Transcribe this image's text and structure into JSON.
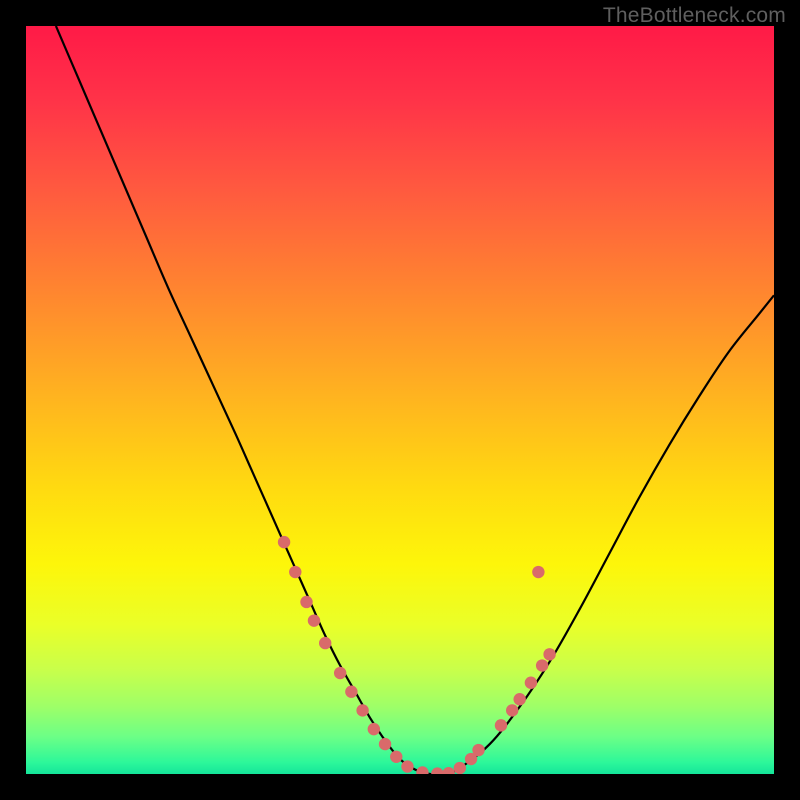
{
  "attribution": "TheBottleneck.com",
  "colors": {
    "frame": "#000000",
    "curve": "#000000",
    "marker": "#d96a6a",
    "gradient_stops": [
      {
        "offset": 0.0,
        "color": "#ff1a47"
      },
      {
        "offset": 0.1,
        "color": "#ff3348"
      },
      {
        "offset": 0.22,
        "color": "#ff5a3f"
      },
      {
        "offset": 0.35,
        "color": "#ff8430"
      },
      {
        "offset": 0.5,
        "color": "#ffb51f"
      },
      {
        "offset": 0.62,
        "color": "#ffdb10"
      },
      {
        "offset": 0.72,
        "color": "#fdf60a"
      },
      {
        "offset": 0.8,
        "color": "#eaff28"
      },
      {
        "offset": 0.86,
        "color": "#c9ff4a"
      },
      {
        "offset": 0.91,
        "color": "#9eff68"
      },
      {
        "offset": 0.95,
        "color": "#6cff86"
      },
      {
        "offset": 0.985,
        "color": "#2cf79a"
      },
      {
        "offset": 1.0,
        "color": "#14e59a"
      }
    ]
  },
  "chart_data": {
    "type": "line",
    "title": "",
    "xlabel": "",
    "ylabel": "",
    "xlim": [
      0,
      100
    ],
    "ylim": [
      0,
      100
    ],
    "grid": false,
    "legend": false,
    "series": [
      {
        "name": "bottleneck-curve",
        "x": [
          4,
          7,
          10,
          13,
          16,
          19,
          22,
          25,
          28,
          30,
          32,
          34,
          36,
          38,
          40,
          42,
          44,
          46,
          48,
          50,
          52,
          54,
          56,
          58,
          62,
          66,
          70,
          74,
          78,
          82,
          86,
          90,
          94,
          98,
          100
        ],
        "y": [
          100,
          93,
          86,
          79,
          72,
          65,
          58.5,
          52,
          45.5,
          41,
          36.5,
          32,
          27.5,
          23,
          18.5,
          14.5,
          11,
          7.5,
          4.5,
          2,
          0.6,
          0,
          0,
          0.8,
          4,
          9,
          15,
          22,
          29.5,
          37,
          44,
          50.5,
          56.5,
          61.5,
          64
        ]
      }
    ],
    "markers": [
      {
        "x": 34.5,
        "y": 31
      },
      {
        "x": 36,
        "y": 27
      },
      {
        "x": 37.5,
        "y": 23
      },
      {
        "x": 38.5,
        "y": 20.5
      },
      {
        "x": 40,
        "y": 17.5
      },
      {
        "x": 42,
        "y": 13.5
      },
      {
        "x": 43.5,
        "y": 11
      },
      {
        "x": 45,
        "y": 8.5
      },
      {
        "x": 46.5,
        "y": 6
      },
      {
        "x": 48,
        "y": 4
      },
      {
        "x": 49.5,
        "y": 2.3
      },
      {
        "x": 51,
        "y": 1
      },
      {
        "x": 53,
        "y": 0.2
      },
      {
        "x": 55,
        "y": 0.05
      },
      {
        "x": 56.5,
        "y": 0.1
      },
      {
        "x": 58,
        "y": 0.8
      },
      {
        "x": 59.5,
        "y": 2
      },
      {
        "x": 60.5,
        "y": 3.2
      },
      {
        "x": 63.5,
        "y": 6.5
      },
      {
        "x": 65,
        "y": 8.5
      },
      {
        "x": 66,
        "y": 10
      },
      {
        "x": 67.5,
        "y": 12.2
      },
      {
        "x": 69,
        "y": 14.5
      },
      {
        "x": 70,
        "y": 16
      },
      {
        "x": 68.5,
        "y": 27
      }
    ]
  }
}
